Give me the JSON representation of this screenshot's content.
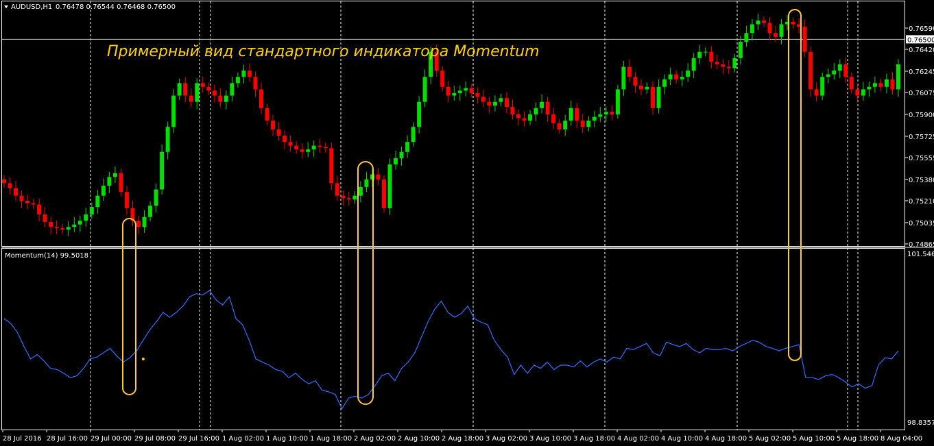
{
  "header": {
    "symbol": "AUDUSD,H1",
    "ohlc": "0.76478 0.76544 0.76468 0.76500"
  },
  "annotation": "Примерный вид стандартного индикатора Momentum",
  "colors": {
    "background": "#000000",
    "bull": "#00e000",
    "bear": "#ff0000",
    "momentum": "#3070ff",
    "highlight": "#ffcc33",
    "grid": "#ffffff"
  },
  "chart_data": [
    {
      "type": "candlestick",
      "title": "AUDUSD,H1",
      "y_ticks": [
        "0.76590",
        "0.76500",
        "0.76420",
        "0.76245",
        "0.76075",
        "0.75900",
        "0.75725",
        "0.75555",
        "0.75380",
        "0.75210",
        "0.75035",
        "0.74865"
      ],
      "ylim": [
        0.74865,
        0.7665
      ],
      "current_price": "0.76500",
      "close": [
        0.7535,
        0.7531,
        0.7525,
        0.7521,
        0.7519,
        0.7518,
        0.751,
        0.7504,
        0.75,
        0.7499,
        0.7498,
        0.75,
        0.7502,
        0.7505,
        0.751,
        0.7516,
        0.7525,
        0.7533,
        0.754,
        0.7543,
        0.7528,
        0.7515,
        0.7505,
        0.75,
        0.7508,
        0.7517,
        0.753,
        0.756,
        0.758,
        0.7605,
        0.7615,
        0.7605,
        0.76,
        0.7615,
        0.7612,
        0.7609,
        0.7605,
        0.76,
        0.7605,
        0.7615,
        0.762,
        0.7625,
        0.762,
        0.761,
        0.7595,
        0.7585,
        0.7578,
        0.7573,
        0.7568,
        0.7565,
        0.7562,
        0.756,
        0.7562,
        0.7565,
        0.7564,
        0.7563,
        0.7535,
        0.7525,
        0.7523,
        0.7522,
        0.7525,
        0.7532,
        0.7538,
        0.7542,
        0.7538,
        0.7515,
        0.755,
        0.7555,
        0.756,
        0.7568,
        0.758,
        0.76,
        0.762,
        0.764,
        0.7625,
        0.7612,
        0.7605,
        0.7607,
        0.7609,
        0.7611,
        0.7607,
        0.7604,
        0.76,
        0.7597,
        0.76,
        0.7603,
        0.7596,
        0.759,
        0.7587,
        0.7585,
        0.759,
        0.7595,
        0.76,
        0.759,
        0.7583,
        0.7578,
        0.7585,
        0.7595,
        0.7585,
        0.758,
        0.7585,
        0.7588,
        0.759,
        0.7592,
        0.759,
        0.761,
        0.7628,
        0.762,
        0.7613,
        0.761,
        0.7612,
        0.7595,
        0.7612,
        0.7618,
        0.7622,
        0.7618,
        0.762,
        0.7625,
        0.7635,
        0.764,
        0.764,
        0.7632,
        0.763,
        0.7628,
        0.7627,
        0.7635,
        0.7648,
        0.7655,
        0.7662,
        0.7665,
        0.7663,
        0.7655,
        0.7652,
        0.7662,
        0.7664,
        0.7662,
        0.766,
        0.764,
        0.761,
        0.7605,
        0.762,
        0.7622,
        0.7625,
        0.763,
        0.762,
        0.761,
        0.7605,
        0.761,
        0.7612,
        0.7615,
        0.7612,
        0.7618,
        0.761,
        0.763
      ],
      "x_ticks": [
        "28 Jul 2016",
        "28 Jul 16:00",
        "29 Jul 00:00",
        "29 Jul 08:00",
        "29 Jul 16:00",
        "1 Aug 02:00",
        "1 Aug 10:00",
        "1 Aug 18:00",
        "2 Aug 02:00",
        "2 Aug 10:00",
        "2 Aug 18:00",
        "3 Aug 02:00",
        "3 Aug 10:00",
        "3 Aug 18:00",
        "4 Aug 02:00",
        "4 Aug 10:00",
        "4 Aug 18:00",
        "5 Aug 02:00",
        "5 Aug 10:00",
        "5 Aug 18:00",
        "8 Aug 04:00"
      ]
    },
    {
      "type": "line",
      "title": "Momentum(14) 99.5018",
      "y_ticks": [
        "101.5463",
        "98.8357"
      ],
      "ylim": [
        98.8357,
        101.5463
      ],
      "series": [
        {
          "values": [
            100.5,
            100.42,
            100.28,
            100.05,
            99.85,
            99.92,
            99.82,
            99.7,
            99.68,
            99.62,
            99.55,
            99.58,
            99.7,
            99.85,
            99.88,
            99.95,
            100.02,
            99.9,
            99.8,
            99.87,
            99.98,
            100.15,
            100.32,
            100.45,
            100.6,
            100.52,
            100.6,
            100.7,
            100.85,
            100.9,
            100.88,
            100.95,
            100.8,
            100.72,
            100.85,
            100.5,
            100.4,
            100.15,
            99.85,
            99.8,
            99.75,
            99.68,
            99.65,
            99.55,
            99.62,
            99.52,
            99.45,
            99.5,
            99.35,
            99.32,
            99.28,
            99.05,
            99.22,
            99.25,
            99.22,
            99.28,
            99.42,
            99.58,
            99.62,
            99.5,
            99.7,
            99.8,
            99.95,
            100.2,
            100.45,
            100.65,
            100.78,
            100.6,
            100.52,
            100.58,
            100.7,
            100.5,
            100.44,
            100.4,
            100.15,
            100.0,
            99.88,
            99.6,
            99.75,
            99.62,
            99.75,
            99.7,
            99.8,
            99.68,
            99.75,
            99.75,
            99.72,
            99.82,
            99.72,
            99.8,
            99.85,
            99.8,
            99.88,
            99.85,
            100.02,
            100.0,
            100.05,
            100.1,
            99.95,
            99.9,
            100.12,
            100.08,
            100.05,
            100.1,
            100.0,
            99.95,
            100.02,
            100.0,
            100.0,
            100.02,
            99.98,
            100.05,
            100.1,
            100.15,
            100.12,
            100.05,
            100.02,
            99.98,
            100.02,
            100.05,
            100.08,
            99.55,
            99.55,
            99.52,
            99.58,
            99.6,
            99.55,
            99.48,
            99.4,
            99.45,
            99.38,
            99.42,
            99.75,
            99.87,
            99.85,
            99.98
          ],
          "dot_value": 99.85
        }
      ]
    }
  ]
}
